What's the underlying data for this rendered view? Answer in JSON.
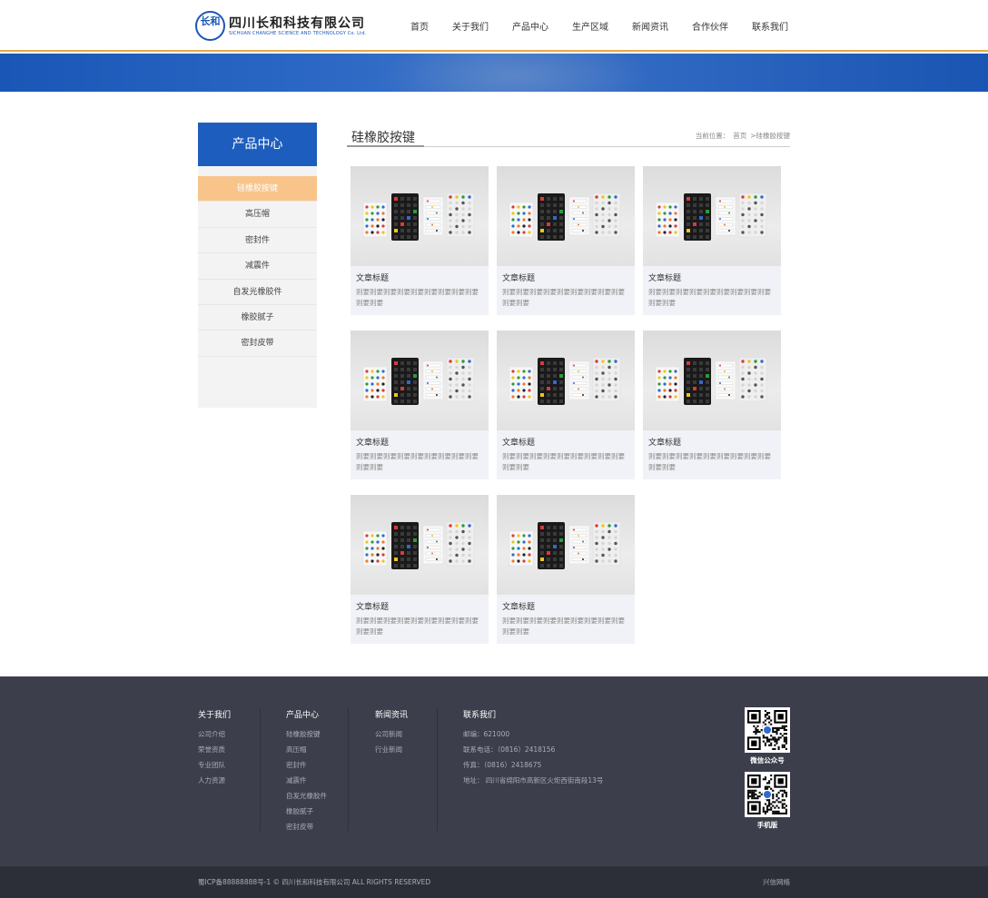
{
  "header": {
    "logo_mark": "长和",
    "company_name": "四川长和科技有限公司",
    "company_name_en": "SICHUAN CHANGHE SCIENCE AND TECHNOLOGY Co. Ltd.",
    "nav": [
      "首页",
      "关于我们",
      "产品中心",
      "生产区域",
      "新闻资讯",
      "合作伙伴",
      "联系我们"
    ]
  },
  "sidebar": {
    "title": "产品中心",
    "items": [
      "硅橡胶按键",
      "高压帽",
      "密封件",
      "减震件",
      "自发光橡胶件",
      "橡胶腻子",
      "密封皮带"
    ],
    "active_index": 0
  },
  "content": {
    "title": "硅橡胶按键",
    "breadcrumb": {
      "label": "当前位置：",
      "home": "首页",
      "current": ">硅橡胶按键"
    },
    "products": [
      {
        "title": "文章标题",
        "desc": "则要则要则要则要则要则要则要则要则要则要则要"
      },
      {
        "title": "文章标题",
        "desc": "则要则要则要则要则要则要则要则要则要则要则要"
      },
      {
        "title": "文章标题",
        "desc": "则要则要则要则要则要则要则要则要则要则要则要"
      },
      {
        "title": "文章标题",
        "desc": "则要则要则要则要则要则要则要则要则要则要则要"
      },
      {
        "title": "文章标题",
        "desc": "则要则要则要则要则要则要则要则要则要则要则要"
      },
      {
        "title": "文章标题",
        "desc": "则要则要则要则要则要则要则要则要则要则要则要"
      },
      {
        "title": "文章标题",
        "desc": "则要则要则要则要则要则要则要则要则要则要则要"
      },
      {
        "title": "文章标题",
        "desc": "则要则要则要则要则要则要则要则要则要则要则要"
      }
    ]
  },
  "footer": {
    "about": {
      "title": "关于我们",
      "links": [
        "公司介绍",
        "荣誉资质",
        "专业团队",
        "人力资源"
      ]
    },
    "products": {
      "title": "产品中心",
      "links": [
        "硅橡胶按键",
        "高压帽",
        "密封件",
        "减震件",
        "自发光橡胶件",
        "橡胶腻子",
        "密封皮带"
      ]
    },
    "news": {
      "title": "新闻资讯",
      "links": [
        "公司新闻",
        "行业新闻"
      ]
    },
    "contact": {
      "title": "联系我们",
      "lines": [
        "邮编：621000",
        "联系电话：（0816）2418156",
        "传真：（0816）2418675",
        "地址： 四川省绵阳市高新区火炬西街南段13号"
      ]
    },
    "qr_wechat_label": "微信公众号",
    "qr_mobile_label": "手机版",
    "copyright": "蜀ICP备88888888号-1 © 四川长和科技有限公司 ALL RIGHTS RESERVED",
    "credit": "兴信网络"
  },
  "colors": {
    "brand_blue": "#1d5dbe",
    "accent_orange": "#e8a84c",
    "active_sidebar": "#f8c48a",
    "footer_bg": "#3c3f4b"
  }
}
